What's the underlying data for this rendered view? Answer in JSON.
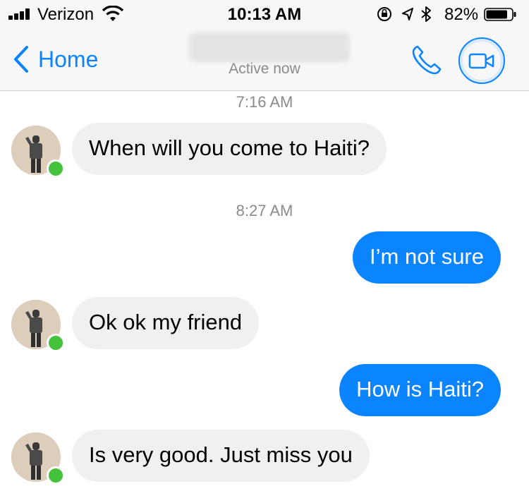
{
  "status_bar": {
    "carrier": "Verizon",
    "time": "10:13 AM",
    "battery_percent": "82%",
    "battery_level": 0.82
  },
  "nav": {
    "back_label": "Home",
    "presence_text": "Active now",
    "accent_color": "#0a84ff"
  },
  "conversation": {
    "timestamps": [
      "7:16 AM",
      "8:27 AM"
    ],
    "messages": [
      {
        "direction": "incoming",
        "text": "When will you come to Haiti?"
      },
      {
        "direction": "outgoing",
        "text": "I’m not sure"
      },
      {
        "direction": "incoming",
        "text": "Ok ok my friend"
      },
      {
        "direction": "outgoing",
        "text": "How is Haiti?"
      },
      {
        "direction": "incoming",
        "text": "Is very good. Just miss you"
      }
    ]
  },
  "colors": {
    "incoming_bubble": "#f1f0f0",
    "outgoing_bubble": "#0a84ff",
    "online_dot": "#44c23b"
  },
  "icons": [
    "signal-icon",
    "wifi-icon",
    "rotation-lock-icon",
    "location-icon",
    "bluetooth-icon",
    "battery-icon",
    "chevron-left-icon",
    "phone-icon",
    "video-camera-icon"
  ]
}
